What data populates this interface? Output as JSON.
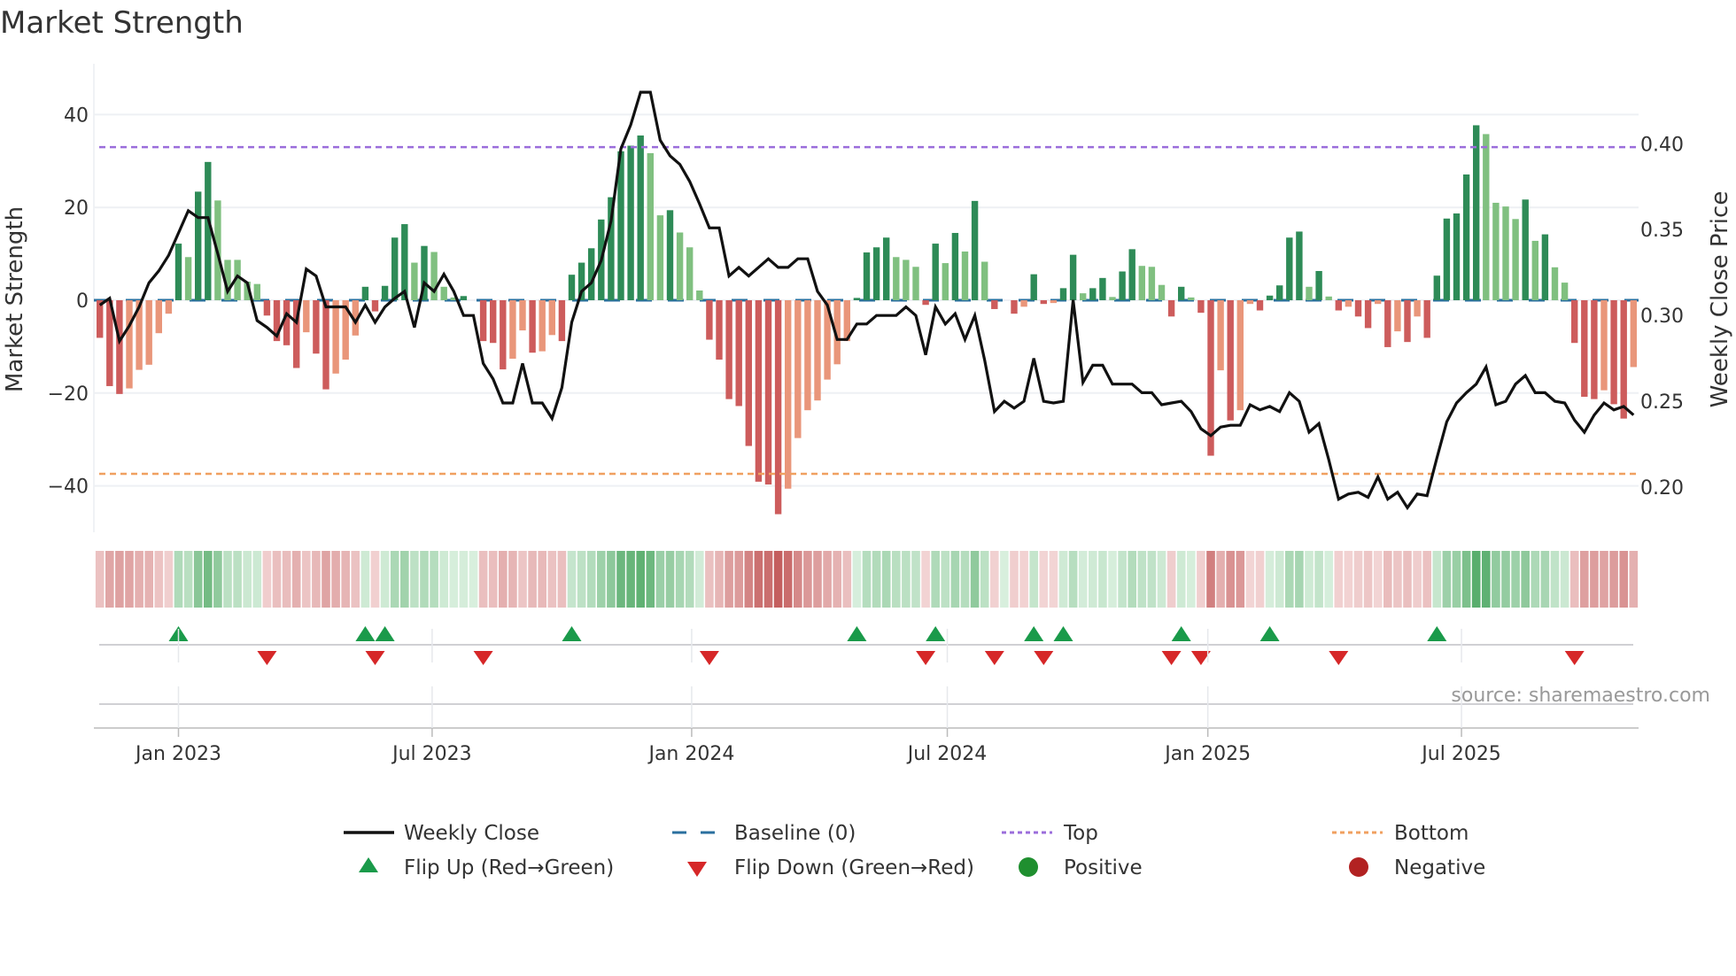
{
  "chart_data": {
    "type": "bar",
    "title": "Market Strength",
    "ylabel": "Market Strength",
    "y2label": "Weekly Close Price",
    "ylim": [
      -50,
      50
    ],
    "y2lim": [
      0.1737,
      0.444
    ],
    "yticks": [
      40,
      20,
      0,
      -20,
      -40
    ],
    "yticklabels": [
      "40",
      "20",
      "0",
      "−20",
      "−40"
    ],
    "y2ticks": [
      0.4,
      0.35,
      0.3,
      0.25,
      0.2
    ],
    "y2ticklabels": [
      "0.40",
      "0.35",
      "0.30",
      "0.25",
      "0.20"
    ],
    "xticks": [
      {
        "label": "Jan 2023",
        "week": 8.0
      },
      {
        "label": "Jul 2023",
        "week": 33.8
      },
      {
        "label": "Jan 2024",
        "week": 60.2
      },
      {
        "label": "Jul 2024",
        "week": 86.2
      },
      {
        "label": "Jan 2025",
        "week": 112.7
      },
      {
        "label": "Jul 2025",
        "week": 138.5
      }
    ],
    "top_level": 33,
    "bottom_level": -37.4,
    "baseline": 0,
    "grid": true,
    "strength": [
      -8.1,
      -18.5,
      -20.2,
      -19,
      -15,
      -13.9,
      -7.1,
      -2.9,
      12.2,
      9.3,
      23.4,
      29.8,
      21.5,
      8.7,
      8.7,
      4.0,
      3.5,
      -3.3,
      -8.8,
      -9.7,
      -14.6,
      -6.9,
      -11.5,
      -19.2,
      -15.8,
      -12.8,
      -7.6,
      2.9,
      -2.4,
      3.1,
      13.5,
      16.4,
      8.1,
      11.7,
      10.4,
      2.9,
      0.6,
      0.9,
      0,
      -8.8,
      -9.2,
      -14.9,
      -12.6,
      -6.5,
      -11.3,
      -11.0,
      -7.5,
      -8.8,
      5.5,
      8.1,
      11.2,
      17.4,
      22.2,
      32.1,
      33.3,
      35.5,
      31.7,
      18.3,
      19.4,
      14.6,
      11.4,
      2.1,
      -8.5,
      -12.8,
      -21.3,
      -22.8,
      -31.4,
      -39.1,
      -39.7,
      -46.1,
      -40.6,
      -29.7,
      -23.7,
      -21.6,
      -17.1,
      -13.8,
      -8.8,
      0.5,
      10.3,
      11.4,
      13.5,
      9.3,
      8.7,
      7.2,
      -1.0,
      12.2,
      8.0,
      14.5,
      10.5,
      21.4,
      8.3,
      -1.9,
      0,
      -2.9,
      -1.4,
      5.6,
      -0.8,
      -0.6,
      2.6,
      9.8,
      1.5,
      2.6,
      4.8,
      0.7,
      6.2,
      11.0,
      7.4,
      7.2,
      3.3,
      -3.5,
      2.9,
      0.6,
      -2.7,
      -33.5,
      -15.1,
      -25.9,
      -23.7,
      -0.8,
      -2.2,
      1.0,
      3.2,
      13.5,
      14.8,
      2.9,
      6.3,
      0.8,
      -2.2,
      -1.4,
      -3.5,
      -6.0,
      -0.8,
      -10.1,
      -6.7,
      -9.0,
      -3.5,
      -8.1,
      5.3,
      17.6,
      18.7,
      27.1,
      37.7,
      35.8,
      21.0,
      20.2,
      17.5,
      21.7,
      12.8,
      14.2,
      7.1,
      3.8,
      -9.2,
      -20.8,
      -21.3,
      -19.4,
      -22.4,
      -25.5,
      -14.4
    ],
    "weekly_close": [
      0.306,
      0.31,
      0.285,
      0.294,
      0.305,
      0.319,
      0.326,
      0.335,
      0.348,
      0.361,
      0.357,
      0.357,
      0.336,
      0.314,
      0.323,
      0.319,
      0.297,
      0.293,
      0.288,
      0.301,
      0.296,
      0.327,
      0.323,
      0.305,
      0.305,
      0.305,
      0.296,
      0.306,
      0.296,
      0.305,
      0.31,
      0.314,
      0.293,
      0.319,
      0.314,
      0.324,
      0.314,
      0.3,
      0.3,
      0.272,
      0.263,
      0.249,
      0.249,
      0.272,
      0.249,
      0.249,
      0.24,
      0.258,
      0.296,
      0.314,
      0.319,
      0.332,
      0.355,
      0.397,
      0.411,
      0.43,
      0.43,
      0.402,
      0.393,
      0.388,
      0.378,
      0.365,
      0.351,
      0.351,
      0.323,
      0.328,
      0.323,
      0.328,
      0.333,
      0.328,
      0.328,
      0.333,
      0.333,
      0.314,
      0.306,
      0.286,
      0.286,
      0.295,
      0.295,
      0.3,
      0.3,
      0.3,
      0.305,
      0.3,
      0.277,
      0.305,
      0.295,
      0.301,
      0.286,
      0.3,
      0.274,
      0.244,
      0.25,
      0.246,
      0.25,
      0.275,
      0.25,
      0.249,
      0.25,
      0.309,
      0.261,
      0.271,
      0.271,
      0.26,
      0.26,
      0.26,
      0.255,
      0.255,
      0.248,
      0.249,
      0.25,
      0.244,
      0.234,
      0.23,
      0.235,
      0.236,
      0.236,
      0.248,
      0.245,
      0.247,
      0.244,
      0.255,
      0.25,
      0.232,
      0.237,
      0.216,
      0.193,
      0.196,
      0.197,
      0.194,
      0.206,
      0.193,
      0.197,
      0.188,
      0.196,
      0.195,
      0.217,
      0.238,
      0.249,
      0.255,
      0.26,
      0.27,
      0.248,
      0.25,
      0.26,
      0.265,
      0.255,
      0.255,
      0.25,
      0.249,
      0.239,
      0.232,
      0.242,
      0.249,
      0.245,
      0.247,
      0.242
    ],
    "legend": {
      "placement": "bottom",
      "items": [
        {
          "label": "Weekly Close",
          "kind": "line"
        },
        {
          "label": "Baseline (0)",
          "kind": "dash"
        },
        {
          "label": "Top",
          "kind": "dot-purple"
        },
        {
          "label": "Bottom",
          "kind": "dot-orange"
        },
        {
          "label": "Flip Up (Red→Green)",
          "kind": "tri-up"
        },
        {
          "label": "Flip Down (Green→Red)",
          "kind": "tri-down"
        },
        {
          "label": "Positive",
          "kind": "circle-green"
        },
        {
          "label": "Negative",
          "kind": "circle-red"
        }
      ]
    },
    "source": "source: sharemaestro.com"
  },
  "colors": {
    "pos_rising": "#2e8b57",
    "pos_falling": "#80c080",
    "neg_falling": "#cd5c5c",
    "neg_rising": "#e9967a",
    "line": "#111111",
    "baseline": "#2a6f9e",
    "top": "#9b6ddb",
    "bottom": "#f0a060",
    "flip_up": "#1a9a4a",
    "flip_down": "#d62728",
    "positive": "#1f8f2f",
    "negative": "#b22222"
  }
}
